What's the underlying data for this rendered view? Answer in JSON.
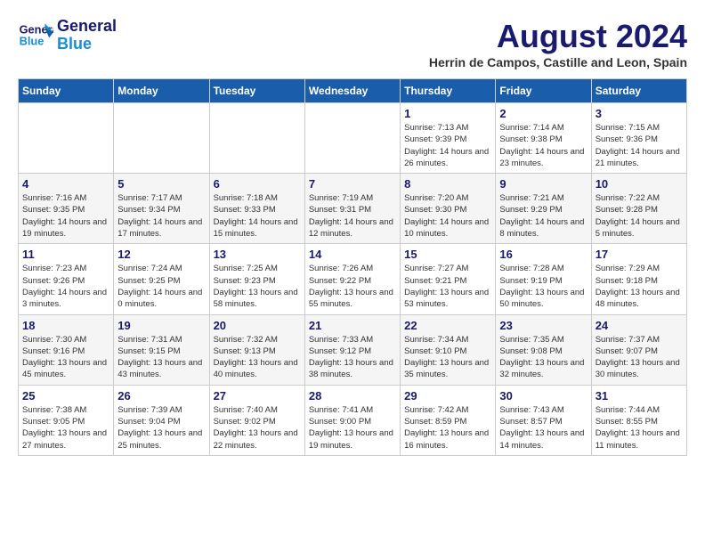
{
  "header": {
    "logo_line1": "General",
    "logo_line2": "Blue",
    "month_year": "August 2024",
    "location": "Herrin de Campos, Castille and Leon, Spain"
  },
  "days_of_week": [
    "Sunday",
    "Monday",
    "Tuesday",
    "Wednesday",
    "Thursday",
    "Friday",
    "Saturday"
  ],
  "weeks": [
    {
      "days": [
        {
          "number": "",
          "empty": true
        },
        {
          "number": "",
          "empty": true
        },
        {
          "number": "",
          "empty": true
        },
        {
          "number": "",
          "empty": true
        },
        {
          "number": "1",
          "sunrise": "7:13 AM",
          "sunset": "9:39 PM",
          "daylight": "14 hours and 26 minutes."
        },
        {
          "number": "2",
          "sunrise": "7:14 AM",
          "sunset": "9:38 PM",
          "daylight": "14 hours and 23 minutes."
        },
        {
          "number": "3",
          "sunrise": "7:15 AM",
          "sunset": "9:36 PM",
          "daylight": "14 hours and 21 minutes."
        }
      ]
    },
    {
      "days": [
        {
          "number": "4",
          "sunrise": "7:16 AM",
          "sunset": "9:35 PM",
          "daylight": "14 hours and 19 minutes."
        },
        {
          "number": "5",
          "sunrise": "7:17 AM",
          "sunset": "9:34 PM",
          "daylight": "14 hours and 17 minutes."
        },
        {
          "number": "6",
          "sunrise": "7:18 AM",
          "sunset": "9:33 PM",
          "daylight": "14 hours and 15 minutes."
        },
        {
          "number": "7",
          "sunrise": "7:19 AM",
          "sunset": "9:31 PM",
          "daylight": "14 hours and 12 minutes."
        },
        {
          "number": "8",
          "sunrise": "7:20 AM",
          "sunset": "9:30 PM",
          "daylight": "14 hours and 10 minutes."
        },
        {
          "number": "9",
          "sunrise": "7:21 AM",
          "sunset": "9:29 PM",
          "daylight": "14 hours and 8 minutes."
        },
        {
          "number": "10",
          "sunrise": "7:22 AM",
          "sunset": "9:28 PM",
          "daylight": "14 hours and 5 minutes."
        }
      ]
    },
    {
      "days": [
        {
          "number": "11",
          "sunrise": "7:23 AM",
          "sunset": "9:26 PM",
          "daylight": "14 hours and 3 minutes."
        },
        {
          "number": "12",
          "sunrise": "7:24 AM",
          "sunset": "9:25 PM",
          "daylight": "14 hours and 0 minutes."
        },
        {
          "number": "13",
          "sunrise": "7:25 AM",
          "sunset": "9:23 PM",
          "daylight": "13 hours and 58 minutes."
        },
        {
          "number": "14",
          "sunrise": "7:26 AM",
          "sunset": "9:22 PM",
          "daylight": "13 hours and 55 minutes."
        },
        {
          "number": "15",
          "sunrise": "7:27 AM",
          "sunset": "9:21 PM",
          "daylight": "13 hours and 53 minutes."
        },
        {
          "number": "16",
          "sunrise": "7:28 AM",
          "sunset": "9:19 PM",
          "daylight": "13 hours and 50 minutes."
        },
        {
          "number": "17",
          "sunrise": "7:29 AM",
          "sunset": "9:18 PM",
          "daylight": "13 hours and 48 minutes."
        }
      ]
    },
    {
      "days": [
        {
          "number": "18",
          "sunrise": "7:30 AM",
          "sunset": "9:16 PM",
          "daylight": "13 hours and 45 minutes."
        },
        {
          "number": "19",
          "sunrise": "7:31 AM",
          "sunset": "9:15 PM",
          "daylight": "13 hours and 43 minutes."
        },
        {
          "number": "20",
          "sunrise": "7:32 AM",
          "sunset": "9:13 PM",
          "daylight": "13 hours and 40 minutes."
        },
        {
          "number": "21",
          "sunrise": "7:33 AM",
          "sunset": "9:12 PM",
          "daylight": "13 hours and 38 minutes."
        },
        {
          "number": "22",
          "sunrise": "7:34 AM",
          "sunset": "9:10 PM",
          "daylight": "13 hours and 35 minutes."
        },
        {
          "number": "23",
          "sunrise": "7:35 AM",
          "sunset": "9:08 PM",
          "daylight": "13 hours and 32 minutes."
        },
        {
          "number": "24",
          "sunrise": "7:37 AM",
          "sunset": "9:07 PM",
          "daylight": "13 hours and 30 minutes."
        }
      ]
    },
    {
      "days": [
        {
          "number": "25",
          "sunrise": "7:38 AM",
          "sunset": "9:05 PM",
          "daylight": "13 hours and 27 minutes."
        },
        {
          "number": "26",
          "sunrise": "7:39 AM",
          "sunset": "9:04 PM",
          "daylight": "13 hours and 25 minutes."
        },
        {
          "number": "27",
          "sunrise": "7:40 AM",
          "sunset": "9:02 PM",
          "daylight": "13 hours and 22 minutes."
        },
        {
          "number": "28",
          "sunrise": "7:41 AM",
          "sunset": "9:00 PM",
          "daylight": "13 hours and 19 minutes."
        },
        {
          "number": "29",
          "sunrise": "7:42 AM",
          "sunset": "8:59 PM",
          "daylight": "13 hours and 16 minutes."
        },
        {
          "number": "30",
          "sunrise": "7:43 AM",
          "sunset": "8:57 PM",
          "daylight": "13 hours and 14 minutes."
        },
        {
          "number": "31",
          "sunrise": "7:44 AM",
          "sunset": "8:55 PM",
          "daylight": "13 hours and 11 minutes."
        }
      ]
    }
  ]
}
